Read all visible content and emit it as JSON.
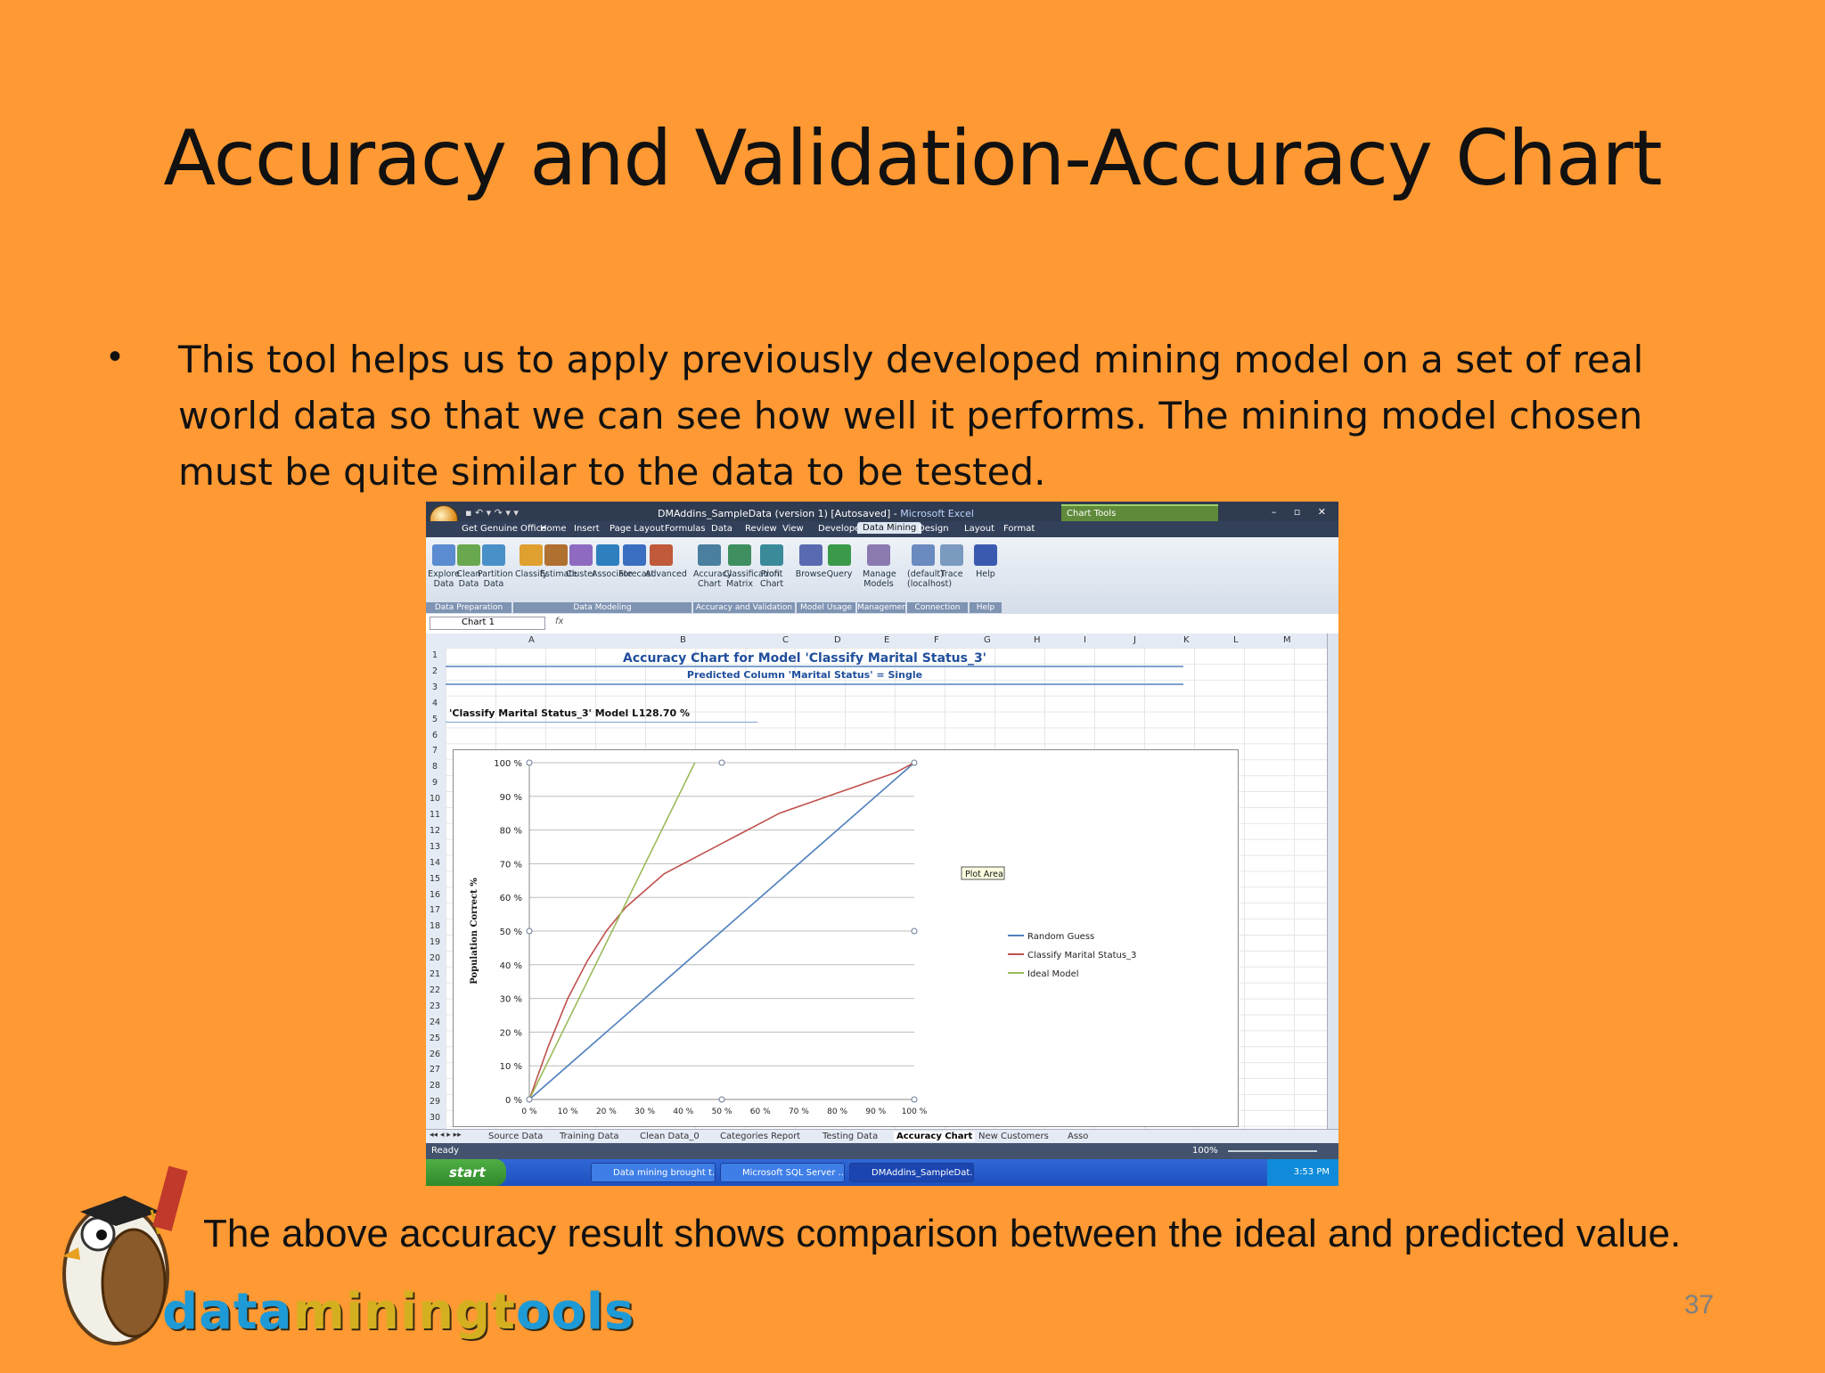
{
  "slide": {
    "title": "Accuracy and Validation-Accuracy Chart",
    "bullet": "This tool helps us to apply previously developed mining model on a set of real world data so that we can see how well it performs. The mining model chosen must be quite similar to the data to be tested.",
    "caption": "The above accuracy result shows comparison between the ideal and predicted value.",
    "page_number": "37",
    "logo_text": "dataminingtools"
  },
  "excel": {
    "window_title": "DMAddins_SampleData (version 1) [Autosaved]",
    "app_name": "Microsoft Excel",
    "chart_tools": "Chart Tools",
    "tabs": [
      "Get Genuine Office",
      "Home",
      "Insert",
      "Page Layout",
      "Formulas",
      "Data",
      "Review",
      "View",
      "Developer",
      "Data Mining",
      "Design",
      "Layout",
      "Format"
    ],
    "ribbon_buttons": [
      "Explore Data",
      "Clean Data",
      "Partition Data",
      "Classify",
      "Estimate",
      "Cluster",
      "Associate",
      "Forecast",
      "Advanced",
      "Accuracy Chart",
      "Classification Matrix",
      "Profit Chart",
      "Browse",
      "Query",
      "Manage Models",
      "(default) (localhost)",
      "Trace",
      "Help"
    ],
    "ribbon_groups": [
      "Data Preparation",
      "Data Modeling",
      "Accuracy and Validation",
      "Model Usage",
      "Management",
      "Connection",
      "Help"
    ],
    "name_box": "Chart 1",
    "fx": "fx",
    "columns": [
      "A",
      "B",
      "C",
      "D",
      "E",
      "F",
      "G",
      "H",
      "I",
      "J",
      "K",
      "L",
      "M"
    ],
    "rows": [
      "1",
      "2",
      "3",
      "4",
      "5",
      "6",
      "7",
      "8",
      "9",
      "10",
      "11",
      "12",
      "13",
      "14",
      "15",
      "16",
      "17",
      "18",
      "19",
      "20",
      "21",
      "22",
      "23",
      "24",
      "25",
      "26",
      "27",
      "28",
      "29",
      "30"
    ],
    "cell_A4": "'Classify Marital Status_3' Model L",
    "cell_B4": "128.70 %",
    "sheet_tabs": [
      "Source Data",
      "Training Data",
      "Clean Data_0",
      "Categories Report",
      "Testing Data",
      "Accuracy Chart",
      "New Customers",
      "Asso"
    ],
    "active_sheet": "Accuracy Chart",
    "status": "Ready",
    "zoom": "100%",
    "taskbar": {
      "start": "start",
      "items": [
        "Data mining brought t...",
        "Microsoft SQL Server ...",
        "DMAddins_SampleDat..."
      ],
      "clock": "3:53 PM"
    },
    "plot_area_tooltip": "Plot Area"
  },
  "chart_data": {
    "type": "line",
    "title": "Accuracy Chart for Model 'Classify Marital Status_3'",
    "subtitle": "Predicted Column 'Marital Status' = Single",
    "ylabel": "Population Correct %",
    "xlabel": "",
    "xlim": [
      0,
      100
    ],
    "ylim": [
      0,
      100
    ],
    "yticks": [
      "0 %",
      "10 %",
      "20 %",
      "30 %",
      "40 %",
      "50 %",
      "60 %",
      "70 %",
      "80 %",
      "90 %",
      "100 %"
    ],
    "xticks": [
      "0 %",
      "10 %",
      "20 %",
      "30 %",
      "40 %",
      "50 %",
      "60 %",
      "70 %",
      "80 %",
      "90 %",
      "100 %"
    ],
    "legend_position": "right",
    "grid": true,
    "series": [
      {
        "name": "Random Guess",
        "color": "#4f81bd",
        "x": [
          0,
          100
        ],
        "y": [
          0,
          100
        ]
      },
      {
        "name": "Classify Marital Status_3",
        "color": "#c0504d",
        "x": [
          0,
          5,
          10,
          15,
          20,
          25,
          30,
          35,
          40,
          45,
          50,
          55,
          60,
          65,
          70,
          75,
          80,
          85,
          90,
          95,
          100
        ],
        "y": [
          0,
          16,
          30,
          41,
          50,
          57,
          62,
          67,
          70,
          73,
          76,
          79,
          82,
          85,
          87,
          89,
          91,
          93,
          95,
          97,
          100
        ]
      },
      {
        "name": "Ideal Model",
        "color": "#9bbb59",
        "x": [
          0,
          43
        ],
        "y": [
          0,
          100
        ]
      }
    ]
  }
}
